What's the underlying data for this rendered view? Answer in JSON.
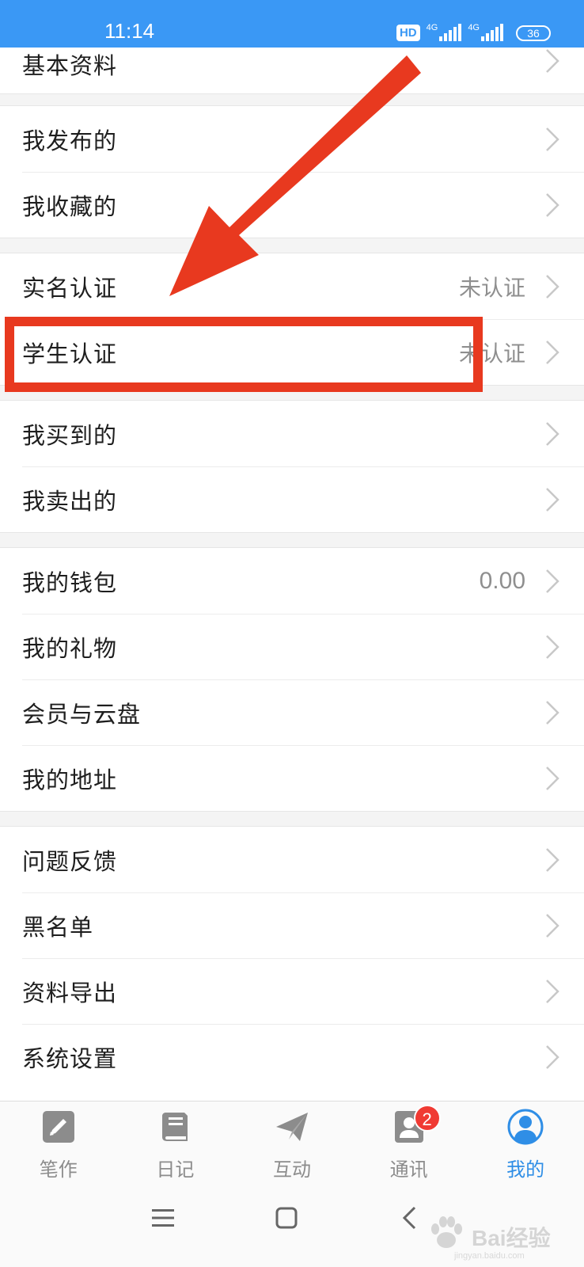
{
  "status_bar": {
    "time": "11:14",
    "hd_label": "HD",
    "net1": "4G",
    "net2": "4G",
    "battery": "36"
  },
  "menu": {
    "items": [
      {
        "label": "基本资料",
        "value": ""
      },
      {
        "label": "我发布的",
        "value": ""
      },
      {
        "label": "我收藏的",
        "value": ""
      },
      {
        "label": "实名认证",
        "value": "未认证"
      },
      {
        "label": "学生认证",
        "value": "未认证"
      },
      {
        "label": "我买到的",
        "value": ""
      },
      {
        "label": "我卖出的",
        "value": ""
      },
      {
        "label": "我的钱包",
        "value": "0.00"
      },
      {
        "label": "我的礼物",
        "value": ""
      },
      {
        "label": "会员与云盘",
        "value": ""
      },
      {
        "label": "我的地址",
        "value": ""
      },
      {
        "label": "问题反馈",
        "value": ""
      },
      {
        "label": "黑名单",
        "value": ""
      },
      {
        "label": "资料导出",
        "value": ""
      },
      {
        "label": "系统设置",
        "value": ""
      }
    ]
  },
  "tabs": [
    {
      "label": "笔作",
      "icon": "pencil-icon"
    },
    {
      "label": "日记",
      "icon": "book-icon"
    },
    {
      "label": "互动",
      "icon": "paper-plane-icon"
    },
    {
      "label": "通讯",
      "icon": "contacts-icon",
      "badge": "2"
    },
    {
      "label": "我的",
      "icon": "user-icon",
      "active": true
    }
  ],
  "watermark": {
    "text": "Bai经验",
    "sub": "jingyan.baidu.com"
  },
  "colors": {
    "status_bar": "#3a98f5",
    "accent": "#2f8ee6",
    "annotation": "#e8391f",
    "badge": "#f03a33"
  }
}
